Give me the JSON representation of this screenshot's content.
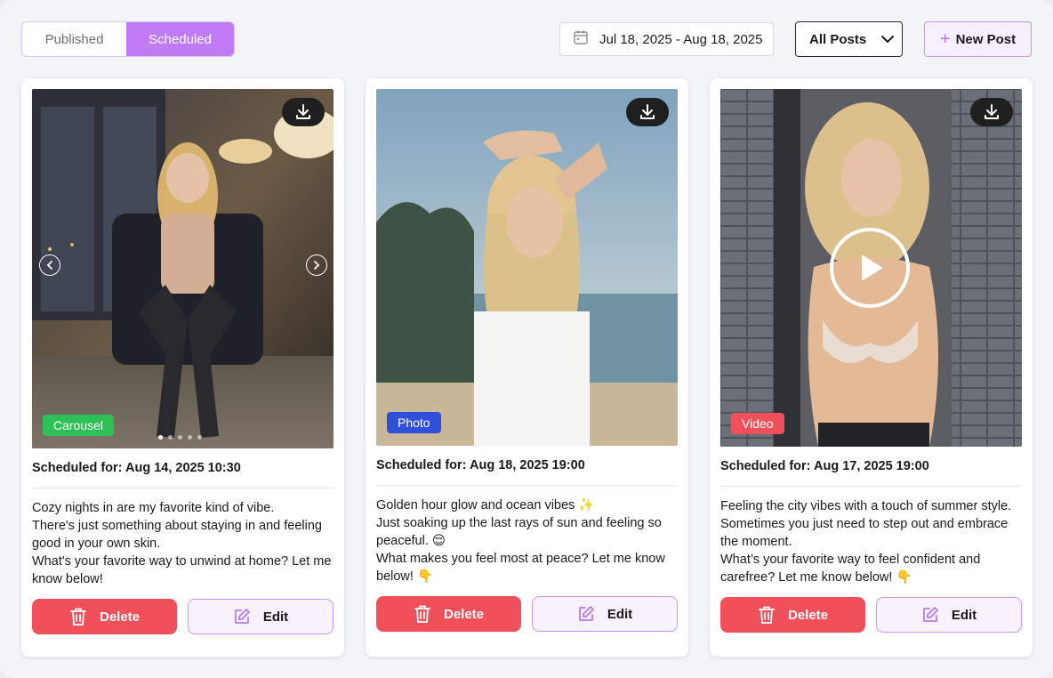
{
  "tabs": [
    {
      "label": "Published",
      "active": false
    },
    {
      "label": "Scheduled",
      "active": true
    }
  ],
  "date_range": {
    "label": "Jul 18, 2025 - Aug 18, 2025",
    "icon": "calendar-icon"
  },
  "filter": {
    "label": "All Posts",
    "icon": "chevron-down-icon"
  },
  "new_post": {
    "label": "New Post",
    "icon": "plus-icon"
  },
  "colors": {
    "accent": "#c07bf5",
    "delete": "#ef5059",
    "carousel_badge": "#2fbf57",
    "photo_badge": "#2f4fd8",
    "video_badge": "#ef5059"
  },
  "cards": [
    {
      "type_badge": "Carousel",
      "scheduled": "Scheduled for: Aug 14, 2025 10:30",
      "caption": [
        "Cozy nights in are my favorite kind of vibe.",
        "There's just something about staying in and feeling good in your own skin.",
        "What's your favorite way to unwind at home? Let me know below!"
      ],
      "delete_label": "Delete",
      "edit_label": "Edit",
      "carousel_total": 5,
      "carousel_index": 1
    },
    {
      "type_badge": "Photo",
      "scheduled": "Scheduled for: Aug 18, 2025 19:00",
      "caption": [
        "Golden hour glow and ocean vibes ✨",
        "Just soaking up the last rays of sun and feeling so peaceful. 😌",
        "What makes you feel most at peace? Let me know below! 👇"
      ],
      "delete_label": "Delete",
      "edit_label": "Edit"
    },
    {
      "type_badge": "Video",
      "scheduled": "Scheduled for: Aug 17, 2025 19:00",
      "caption": [
        "Feeling the city vibes with a touch of summer style. Sometimes you just need to step out and embrace the moment.",
        "What’s your favorite way to feel confident and carefree? Let me know below! 👇"
      ],
      "delete_label": "Delete",
      "edit_label": "Edit"
    }
  ]
}
